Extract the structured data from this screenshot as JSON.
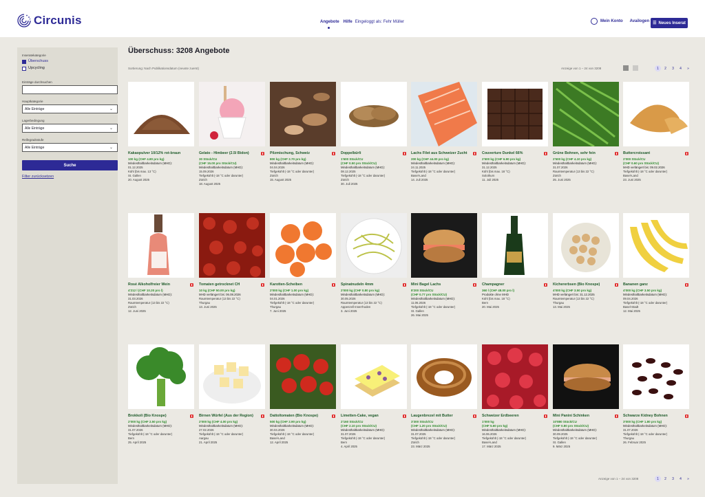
{
  "header": {
    "logo_text": "Circunis",
    "nav_offers": "Angebote",
    "nav_help": "Hilfe",
    "logged_in": "Eingeloggt als: Fehr Müller",
    "my_account": "Mein Konto",
    "my_ads": "Availogen",
    "new_ad_button": "Neues Inserat",
    "brand_color": "#2d2a96"
  },
  "sidebar": {
    "category_label": "Inseratekategorie",
    "cat1": "Überschuss",
    "cat2": "Upcycling",
    "search_label": "Einträge durchsuchen",
    "search_value": "",
    "main_cat_label": "Hauptkategorie",
    "main_cat_value": "Alle Einträge",
    "storage_label": "Lagerbedingung",
    "storage_value": "Alle Einträge",
    "ripeness_label": "Reifegradsstufe",
    "ripeness_value": "Alle Einträge",
    "search_button": "Suche",
    "reset_link": "Filter zurücksetzen"
  },
  "main": {
    "title": "Überschuss: 3208 Angebote",
    "sort": "Sortierung: Nach Publikationsdatum (neuste zuerst)",
    "showing_top": "Anzeige von 1 – 24 von 3208",
    "showing_bottom": "Anzeige von 1 – 24 von 3208",
    "pages": [
      "1",
      "2",
      "3",
      "4",
      "»"
    ]
  },
  "cards": [
    {
      "title": "Kakaopulver 10/12% rot-braun",
      "flag": false,
      "q1": "100 kg  (CHF 4.80 pro kg)",
      "q2": "",
      "l1": "Mindesthaltbarkeitsdatum (MHD):",
      "l2": "01.12.2025",
      "l3": "Kühl (bis max. 13 °C)",
      "l4": "St. Gallen",
      "date": "20. August 2025"
    },
    {
      "title": "Gelato - Himbeer (2.5l Bidon)",
      "flag": true,
      "q1": "30 Stück/CU",
      "q2": "(CHF 15.00 pro Stück/CU)",
      "l1": "Mindesthaltbarkeitsdatum (MHD):",
      "l2": "15.09.2026",
      "l3": "Tiefgekühlt (-18 °C oder darunter)",
      "l4": "Zürich",
      "date": "18. August 2025"
    },
    {
      "title": "Pilzmischung, Schweiz",
      "flag": true,
      "q1": "800 kg  (CHF 2.70 pro kg)",
      "q2": "",
      "l1": "Mindesthaltbarkeitsdatum (MHD):",
      "l2": "04.04.2026",
      "l3": "Tiefgekühlt (-18 °C oder darunter)",
      "l4": "Zürich",
      "date": "15. August 2025"
    },
    {
      "title": "Doppelbürli",
      "flag": true,
      "q1": "1'600 Stück/CU",
      "q2": "(CHF 0.50 pro Stück/CU)",
      "l1": "Mindesthaltbarkeitsdatum (MHD):",
      "l2": "08.12.2025",
      "l3": "Tiefgekühlt (-18 °C oder darunter)",
      "l4": "Zürich",
      "date": "30. Juli 2025"
    },
    {
      "title": "Lachs Filet aus Schweizer Zucht",
      "flag": true,
      "q1": "200 kg  (CHF 44.00 pro kg)",
      "q2": "",
      "l1": "Mindesthaltbarkeitsdatum (MHD):",
      "l2": "24.11.2025",
      "l3": "Tiefgekühlt (-18 °C oder darunter)",
      "l4": "Basel-Land",
      "date": "14. Juli 2025"
    },
    {
      "title": "Couverture Dunkel 66%",
      "flag": true,
      "q1": "2'500 kg  (CHF 6.90 pro kg)",
      "q2": "",
      "l1": "Mindesthaltbarkeitsdatum (MHD):",
      "l2": "31.12.2025",
      "l3": "Kühl (bis max. 18 °C)",
      "l4": "Solothurn",
      "date": "11. Juli 2025"
    },
    {
      "title": "Grüne Bohnen, sehr fein",
      "flag": true,
      "q1": "2'500 kg  (CHF 4.10 pro kg)",
      "q2": "",
      "l1": "Mindesthaltbarkeitsdatum (MHD):",
      "l2": "31.07.2026",
      "l3": "Raumtemperatur (13 bis 22 °C)",
      "l4": "Zürich",
      "date": "25. Juni 2025"
    },
    {
      "title": "Buttercroissant",
      "flag": true,
      "q1": "2'000 Stück/CU",
      "q2": "(CHF 0.60 pro Stück/CU)",
      "l1": "MHD verlängert bis: 09.02.2026",
      "l2": "",
      "l3": "Tiefgekühlt (-18 °C oder darunter)",
      "l4": "Basel-Land",
      "date": "23. Juni 2025"
    },
    {
      "title": "Rosé Alkoholfreier Wein",
      "flag": true,
      "q1": "4'212 l  (CHF 10.20 pro l)",
      "q2": "",
      "l1": "Mindesthaltbarkeitsdatum (MHD):",
      "l2": "31.03.2026",
      "l3": "Raumtemperatur (13 bis 22 °C)",
      "l4": "Zürich",
      "date": "12. Juni 2025"
    },
    {
      "title": "Tomaten getrocknet CH",
      "flag": true,
      "q1": "10 kg  (CHF 50.00 pro kg)",
      "q2": "",
      "l1": "MHD verlängert bis: 06.08.2026",
      "l2": "",
      "l3": "Raumtemperatur (13 bis 22 °C)",
      "l4": "Thurgau",
      "date": "13. Juni 2025"
    },
    {
      "title": "Karotten-Scheiben",
      "flag": true,
      "q1": "2'000 kg  (CHF 1.00 pro kg)",
      "q2": "",
      "l1": "Mindesthaltbarkeitsdatum (MHD):",
      "l2": "04.01.2026",
      "l3": "Tiefgekühlt (-18 °C oder darunter)",
      "l4": "Thurgau",
      "date": "7. Juni 2025"
    },
    {
      "title": "Spinatnudeln 4mm",
      "flag": true,
      "q1": "2'000 kg  (CHF 0.80 pro kg)",
      "q2": "",
      "l1": "Mindesthaltbarkeitsdatum (MHD):",
      "l2": "30.05.2026",
      "l3": "Raumtemperatur (13 bis 22 °C)",
      "l4": "Appenzell Innerrhoden",
      "date": "3. Juni 2025"
    },
    {
      "title": "Mini Bagel Lachs",
      "flag": true,
      "q1": "8'200 Stück/CU",
      "q2": "(CHF 0.77 pro Stück/CU)",
      "l1": "Mindesthaltbarkeitsdatum (MHD):",
      "l2": "11.06.2026",
      "l3": "Tiefgekühlt (-18 °C oder darunter)",
      "l4": "St. Gallen",
      "date": "26. Mai 2025"
    },
    {
      "title": "Champagner",
      "flag": true,
      "q1": "360 l  (CHF 48.00 pro l)",
      "q2": "",
      "l1": "Produkte ohne MHD",
      "l2": "",
      "l3": "Kühl (bis max. 18 °C)",
      "l4": "Bern",
      "date": "20. Mai 2025"
    },
    {
      "title": "Kichererbsen (Bio Knospe)",
      "flag": true,
      "q1": "4'000 kg  (CHF 3.50 pro kg)",
      "q2": "",
      "l1": "MHD verlängert bis: 31.12.2025",
      "l2": "",
      "l3": "Raumtemperatur (13 bis 22 °C)",
      "l4": "Thurgau",
      "date": "13. Mai 2025"
    },
    {
      "title": "Bananen ganz",
      "flag": true,
      "q1": "4'000 kg  (CHF 3.50 pro kg)",
      "q2": "",
      "l1": "Mindesthaltbarkeitsdatum (MHD):",
      "l2": "09.04.2026",
      "l3": "Tiefgekühlt (-18 °C oder darunter)",
      "l4": "Basel-Stadt",
      "date": "12. Mai 2025"
    },
    {
      "title": "Brokkoli (Bio Knospe)",
      "flag": true,
      "q1": "2'000 kg  (CHF 2.50 pro kg)",
      "q2": "",
      "l1": "Mindesthaltbarkeitsdatum (MHD):",
      "l2": "31.07.2026",
      "l3": "Tiefgekühlt (-18 °C oder darunter)",
      "l4": "Bern",
      "date": "25. April 2025"
    },
    {
      "title": "Birnen Würfel (Aus der Region)",
      "flag": true,
      "q1": "2'000 kg  (CHF 4.00 pro kg)",
      "q2": "",
      "l1": "Mindesthaltbarkeitsdatum (MHD):",
      "l2": "27.02.2026",
      "l3": "Tiefgekühlt (-18 °C oder darunter)",
      "l4": "Aargau",
      "date": "21. April 2025"
    },
    {
      "title": "Dattoltomaten (Bio Knospe)",
      "flag": true,
      "q1": "500 kg  (CHF 2.90 pro kg)",
      "q2": "",
      "l1": "Mindesthaltbarkeitsdatum (MHD):",
      "l2": "30.04.2026",
      "l3": "Tiefgekühlt (-18 °C oder darunter)",
      "l4": "Basel-Land",
      "date": "12. April 2025"
    },
    {
      "title": "Limetten-Cake, vegan",
      "flag": true,
      "q1": "2'160 Stück/CU",
      "q2": "(CHF 2.10 pro Stück/CU)",
      "l1": "Mindesthaltbarkeitsdatum (MHD):",
      "l2": "31.07.2026",
      "l3": "Tiefgekühlt (-18 °C oder darunter)",
      "l4": "Bern",
      "date": "4. April 2025"
    },
    {
      "title": "Laugenbrezel mit Butter",
      "flag": true,
      "q1": "3'300 Stück/CU",
      "q2": "(CHF 1.20 pro Stück/CU)",
      "l1": "Mindesthaltbarkeitsdatum (MHD):",
      "l2": "31.07.2025",
      "l3": "Tiefgekühlt (-18 °C oder darunter)",
      "l4": "Zürich",
      "date": "23. März 2025"
    },
    {
      "title": "Schweizer Erdbeeren",
      "flag": true,
      "q1": "1'000 kg",
      "q2": "(CHF 5.60 pro kg)",
      "l1": "Mindesthaltbarkeitsdatum (MHD):",
      "l2": "16.06.2026",
      "l3": "Tiefgekühlt (-18 °C oder darunter)",
      "l4": "Basel-Land",
      "date": "17. März 2025"
    },
    {
      "title": "Mini Panini Schinken",
      "flag": true,
      "q1": "10'880 Stück/CU",
      "q2": "(CHF 0.80 pro Stück/CU)",
      "l1": "Mindesthaltbarkeitsdatum (MHD):",
      "l2": "30.09.2025",
      "l3": "Tiefgekühlt (-18 °C oder darunter)",
      "l4": "St. Gallen",
      "date": "9. März 2025"
    },
    {
      "title": "Schwarze Kidney Bohnen",
      "flag": true,
      "q1": "3'000 kg  (CHF 1.80 pro kg)",
      "q2": "",
      "l1": "Mindesthaltbarkeitsdatum (MHD):",
      "l2": "31.07.2026",
      "l3": "Tiefgekühlt (-18 °C oder darunter)",
      "l4": "Thurgau",
      "date": "26. Februar 2025"
    }
  ]
}
